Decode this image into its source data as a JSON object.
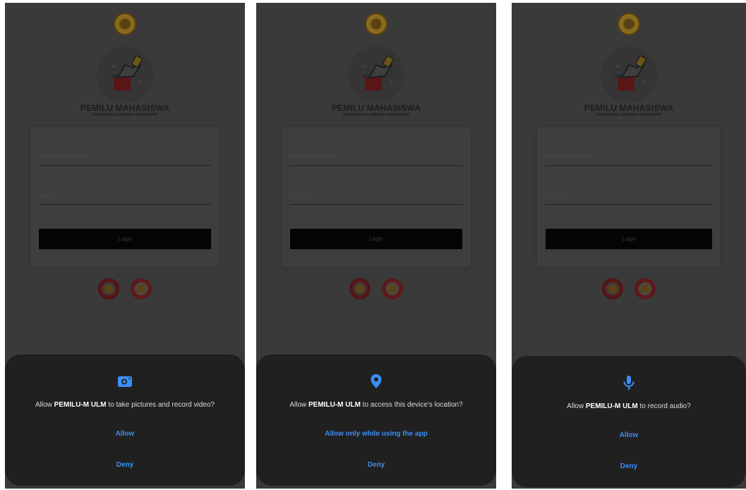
{
  "app": {
    "title": "PEMILU MAHASISWA",
    "subtitle": "UNIVERSITAS LAMBUNG MANGKURAT",
    "nim_label": "Nomor Induk Mahasiswa",
    "password_label": "Kata Sandi",
    "login_label": "Login"
  },
  "dialogs": [
    {
      "icon": "camera-icon",
      "prefix": "Allow ",
      "app_name": "PEMILU-M ULM",
      "suffix": " to take pictures and record video?",
      "allow_label": "Allow",
      "deny_label": "Deny"
    },
    {
      "icon": "location-pin-icon",
      "prefix": "Allow ",
      "app_name": "PEMILU-M ULM",
      "suffix": " to access this device's location?",
      "allow_label": "Allow only while using the app",
      "deny_label": "Deny"
    },
    {
      "icon": "microphone-icon",
      "prefix": "Allow ",
      "app_name": "PEMILU-M ULM",
      "suffix": " to record audio?",
      "allow_label": "Allow",
      "deny_label": "Deny"
    }
  ],
  "colors": {
    "scrim": "#3a3a3a",
    "dialog_bg": "#202020",
    "accent": "#3d8ef7"
  }
}
